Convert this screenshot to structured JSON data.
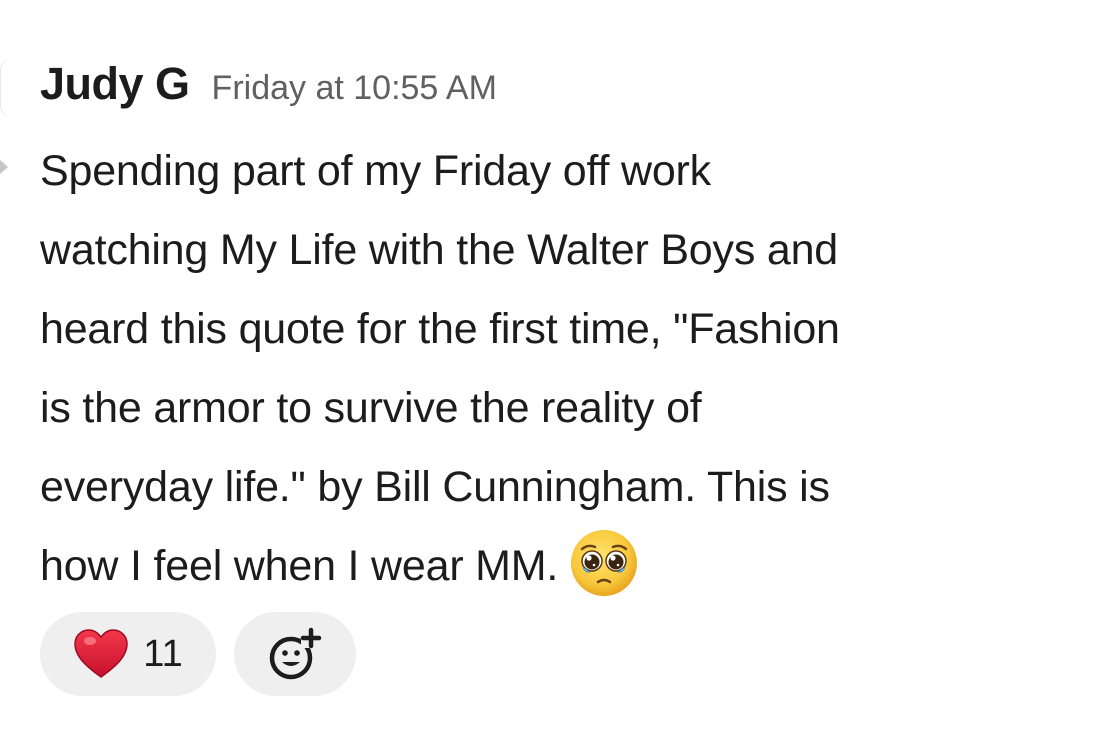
{
  "message": {
    "author": "Judy G",
    "timestamp": "Friday at 10:55 AM",
    "body_lines": [
      "Spending part of my Friday off work",
      "watching My Life with the Walter Boys and",
      "heard this quote for the first time, \"Fashion",
      "is the armor to survive the reality of",
      "everyday life.\" by Bill Cunningham. This is",
      "how I feel when I wear MM."
    ],
    "trailing_emoji": "pleading-face-emoji"
  },
  "reactions": [
    {
      "emoji": "heart-emoji",
      "count": "11"
    }
  ],
  "add_reaction_icon": "add-reaction-icon"
}
